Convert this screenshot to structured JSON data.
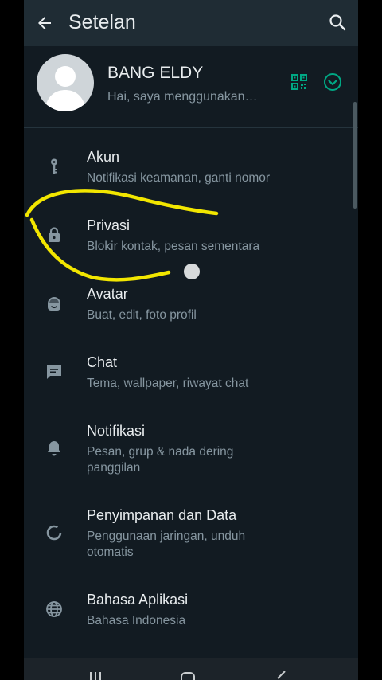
{
  "header": {
    "title": "Setelan",
    "back_icon": "arrow-left-icon",
    "search_icon": "search-icon"
  },
  "profile": {
    "name": "BANG ELDY",
    "status": "Hai, saya menggunakan…",
    "qr_icon": "qr-code-icon",
    "expand_icon": "chevron-down-circle-icon"
  },
  "items": [
    {
      "label": "Akun",
      "sub": "Notifikasi keamanan, ganti nomor",
      "icon": "key-icon"
    },
    {
      "label": "Privasi",
      "sub": "Blokir kontak, pesan sementara",
      "icon": "lock-icon"
    },
    {
      "label": "Avatar",
      "sub": "Buat, edit, foto profil",
      "icon": "avatar-face-icon"
    },
    {
      "label": "Chat",
      "sub": "Tema, wallpaper, riwayat chat",
      "icon": "chat-icon"
    },
    {
      "label": "Notifikasi",
      "sub": "Pesan, grup & nada dering panggilan",
      "icon": "bell-icon"
    },
    {
      "label": "Penyimpanan dan Data",
      "sub": "Penggunaan jaringan, unduh otomatis",
      "icon": "data-usage-icon"
    },
    {
      "label": "Bahasa Aplikasi",
      "sub": "Bahasa Indonesia",
      "icon": "globe-icon"
    }
  ],
  "colors": {
    "background": "#121b22",
    "appbar": "#1f2c34",
    "accent": "#00a884",
    "primary_text": "#e9edef",
    "secondary_text": "#8696a0",
    "annotation": "#f2e600"
  }
}
